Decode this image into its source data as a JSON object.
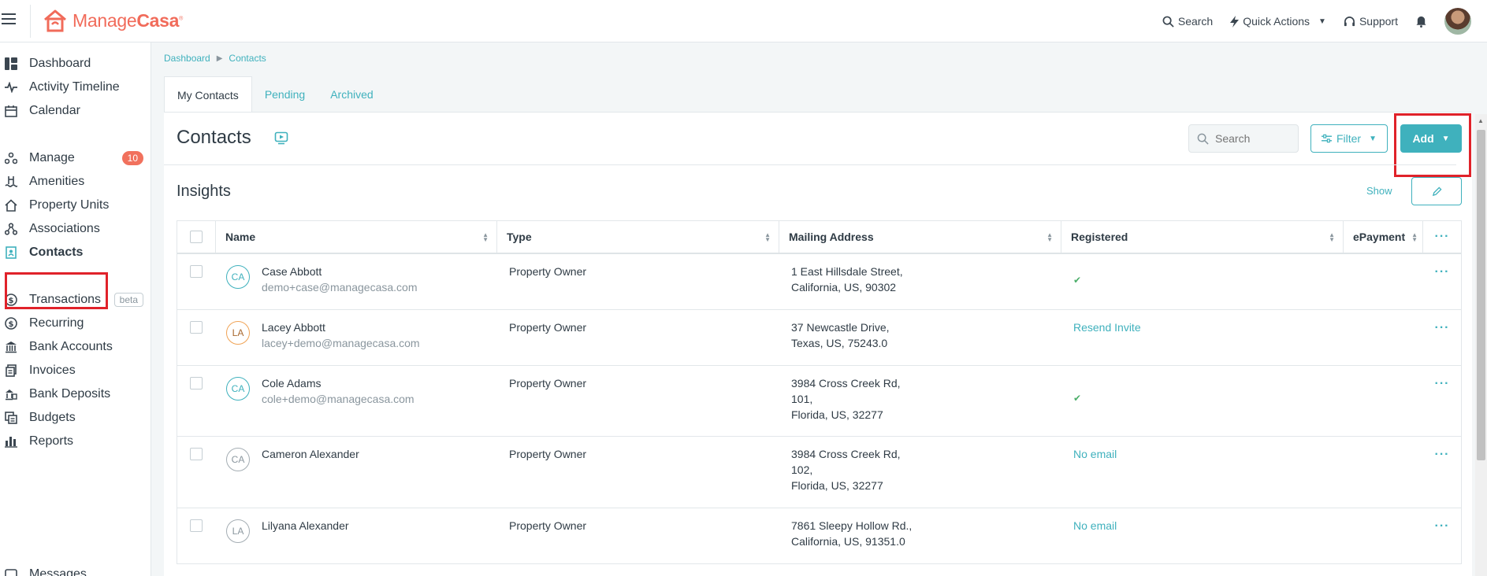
{
  "brand": {
    "name_part1": "Manage",
    "name_part2": "Casa",
    "trademark": "®"
  },
  "topbar": {
    "search_label": "Search",
    "quick_actions_label": "Quick Actions",
    "support_label": "Support"
  },
  "sidebar": {
    "items": [
      {
        "label": "Dashboard"
      },
      {
        "label": "Activity Timeline"
      },
      {
        "label": "Calendar"
      },
      {
        "label": "Manage",
        "badge": "10"
      },
      {
        "label": "Amenities"
      },
      {
        "label": "Property Units"
      },
      {
        "label": "Associations"
      },
      {
        "label": "Contacts"
      },
      {
        "label": "Transactions",
        "tag": "beta"
      },
      {
        "label": "Recurring"
      },
      {
        "label": "Bank Accounts"
      },
      {
        "label": "Invoices"
      },
      {
        "label": "Bank Deposits"
      },
      {
        "label": "Budgets"
      },
      {
        "label": "Reports"
      },
      {
        "label": "Messages"
      }
    ]
  },
  "breadcrumb": {
    "items": [
      "Dashboard",
      "Contacts"
    ]
  },
  "tabs": [
    {
      "label": "My Contacts",
      "active": true
    },
    {
      "label": "Pending"
    },
    {
      "label": "Archived"
    }
  ],
  "page": {
    "title": "Contacts",
    "search_placeholder": "Search",
    "filter_label": "Filter",
    "add_label": "Add",
    "insights_title": "Insights",
    "show_label": "Show"
  },
  "table": {
    "columns": [
      "Name",
      "Type",
      "Mailing Address",
      "Registered",
      "ePayment"
    ],
    "rows": [
      {
        "initials": "CA",
        "name": "Case Abbott",
        "email": "demo+case@managecasa.com",
        "type": "Property Owner",
        "address": [
          "1 East Hillsdale Street,",
          "California, US, 90302"
        ],
        "registered": "✔"
      },
      {
        "initials": "LA",
        "name": "Lacey Abbott",
        "email": "lacey+demo@managecasa.com",
        "type": "Property Owner",
        "address": [
          "37 Newcastle Drive,",
          "Texas, US, 75243.0"
        ],
        "registered": "Resend Invite"
      },
      {
        "initials": "CA",
        "name": "Cole Adams",
        "email": "cole+demo@managecasa.com",
        "type": "Property Owner",
        "address": [
          "3984 Cross Creek Rd,",
          "101,",
          "Florida, US, 32277"
        ],
        "registered": "✔"
      },
      {
        "initials": "CA",
        "name": "Cameron Alexander",
        "email": "",
        "type": "Property Owner",
        "address": [
          "3984 Cross Creek Rd,",
          "102,",
          "Florida, US, 32277"
        ],
        "registered": "No email"
      },
      {
        "initials": "LA",
        "name": "Lilyana Alexander",
        "email": "",
        "type": "Property Owner",
        "address": [
          "7861 Sleepy Hollow Rd.,",
          "California, US, 91351.0"
        ],
        "registered": "No email"
      }
    ]
  },
  "colors": {
    "accent": "#3fb1bd",
    "brand": "#f16b5a",
    "badge": "#f1715d",
    "highlight": "#e0222a"
  }
}
